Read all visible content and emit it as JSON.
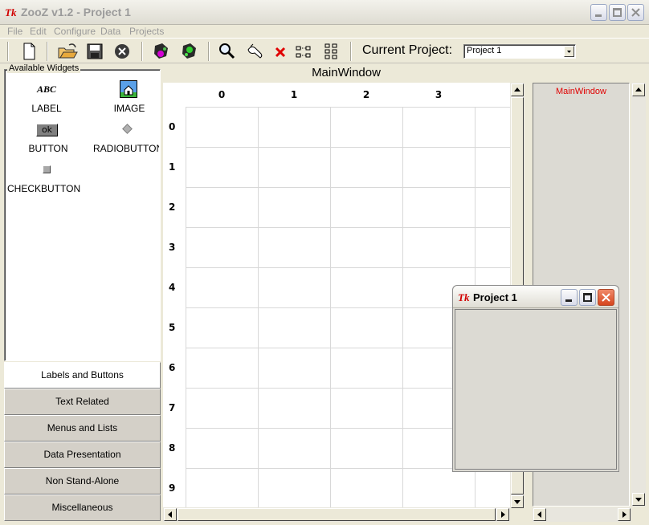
{
  "window": {
    "logo": "Tk",
    "title": "ZooZ v1.2 - Project 1"
  },
  "menu": [
    "File",
    "Edit",
    "Configure",
    "Data",
    "Projects"
  ],
  "toolbar": {
    "icons": [
      "new-file-icon",
      "open-folder-icon",
      "save-disk-icon",
      "close-circle-icon",
      "paint-icon-1",
      "paint-icon-2",
      "magnifier-icon",
      "wrench-hand-icon",
      "delete-x-icon",
      "grid-horizontal-icon",
      "grid-vertical-icon"
    ],
    "current_project_label": "Current Project:",
    "current_project_value": "Project 1"
  },
  "widgets_panel": {
    "title": "Available Widgets",
    "abc_glyph": "ABC",
    "ok_glyph": "ok",
    "items": [
      {
        "label": "LABEL",
        "icon": "abc-text-icon"
      },
      {
        "label": "IMAGE",
        "icon": "house-image-icon"
      },
      {
        "label": "BUTTON",
        "icon": "ok-button-icon"
      },
      {
        "label": "RADIOBUTTON",
        "icon": "radio-diamond-icon"
      },
      {
        "label": "CHECKBUTTON",
        "icon": "check-square-icon"
      }
    ],
    "categories": [
      {
        "label": "Labels and Buttons",
        "active": true
      },
      {
        "label": "Text Related",
        "active": false
      },
      {
        "label": "Menus and Lists",
        "active": false
      },
      {
        "label": "Data Presentation",
        "active": false
      },
      {
        "label": "Non Stand-Alone",
        "active": false
      },
      {
        "label": "Miscellaneous",
        "active": false
      }
    ]
  },
  "main_window": {
    "title": "MainWindow",
    "columns": [
      "0",
      "1",
      "2",
      "3"
    ],
    "rows": [
      "0",
      "1",
      "2",
      "3",
      "4",
      "5",
      "6",
      "7",
      "8",
      "9"
    ]
  },
  "right_panel": {
    "title": "MainWindow",
    "title_color": "#e00000"
  },
  "float_window": {
    "logo": "Tk",
    "title": "Project 1"
  }
}
